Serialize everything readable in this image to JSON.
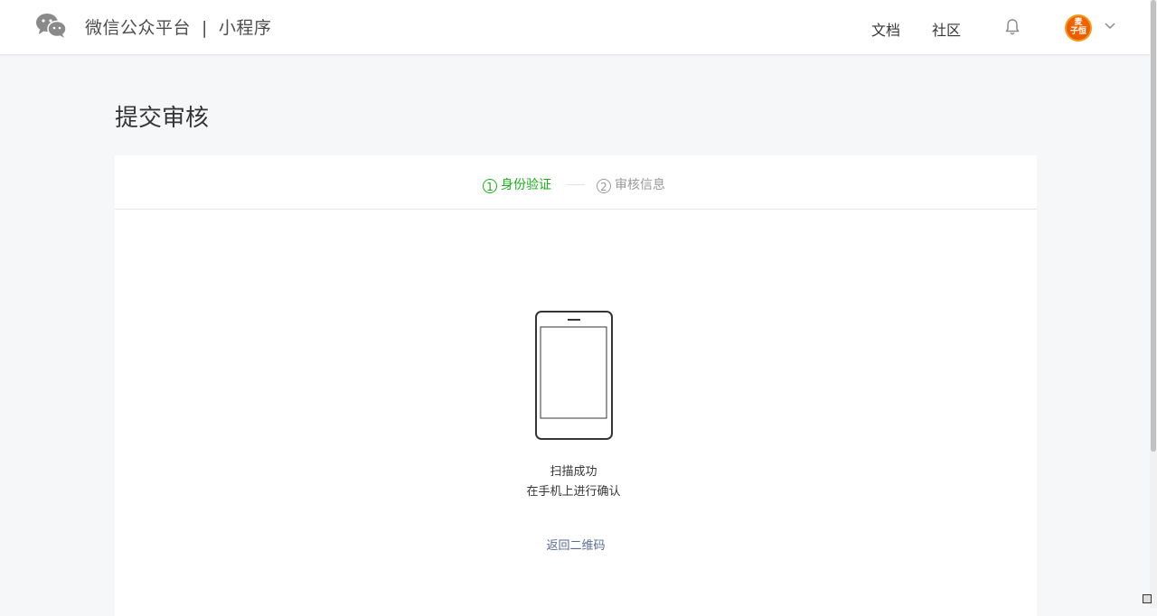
{
  "header": {
    "brand_name": "微信公众平台",
    "brand_separator": "|",
    "product_name": "小程序",
    "nav": [
      {
        "label": "文档"
      },
      {
        "label": "社区"
      }
    ],
    "bell_icon": "bell-icon",
    "avatar_text_line1": "麦",
    "avatar_text_line2": "子恒",
    "chevron_icon": "chevron-down-icon"
  },
  "page": {
    "title": "提交审核"
  },
  "steps": [
    {
      "number": "1",
      "label": "身份验证",
      "state": "active"
    },
    {
      "number": "2",
      "label": "审核信息",
      "state": "inactive"
    }
  ],
  "scan": {
    "icon": "phone-icon",
    "status_line1": "扫描成功",
    "status_line2": "在手机上进行确认",
    "back_link": "返回二维码"
  },
  "colors": {
    "accent_green": "#1aad19",
    "link_blue": "#576b95",
    "muted_gray": "#9a9a9a"
  }
}
